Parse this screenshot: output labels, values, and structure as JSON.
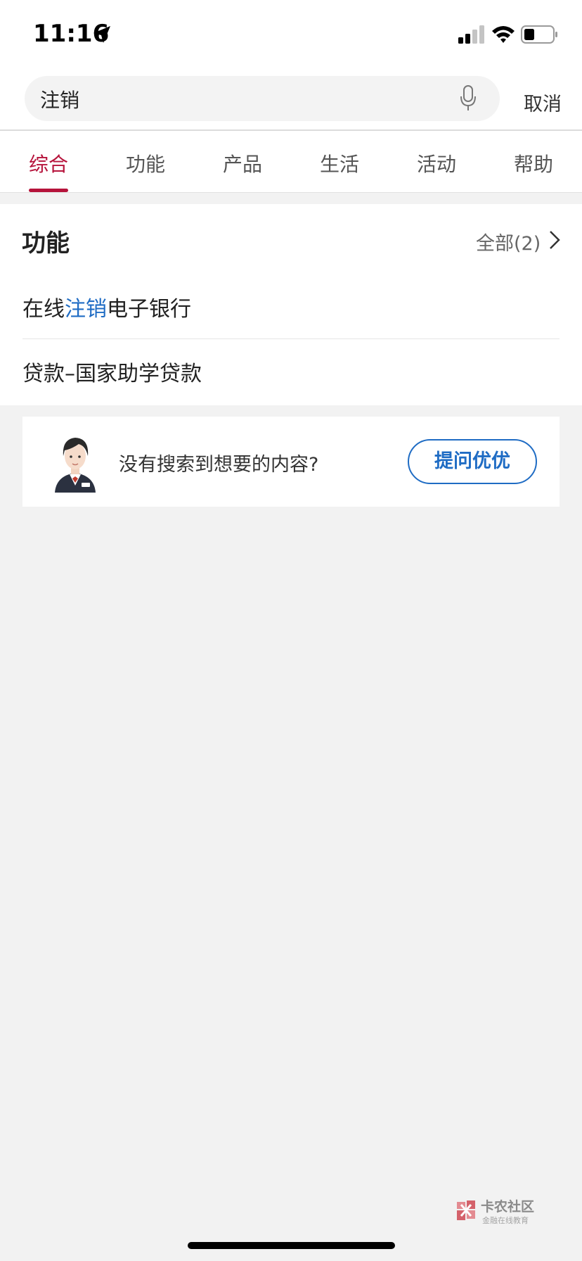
{
  "status_bar": {
    "time": "11:16"
  },
  "search": {
    "query": "注销",
    "cancel_label": "取消"
  },
  "tabs": [
    {
      "label": "综合",
      "active": true
    },
    {
      "label": "功能",
      "active": false
    },
    {
      "label": "产品",
      "active": false
    },
    {
      "label": "生活",
      "active": false
    },
    {
      "label": "活动",
      "active": false
    },
    {
      "label": "帮助",
      "active": false
    }
  ],
  "function_section": {
    "title": "功能",
    "all_label": "全部(2)",
    "results": [
      {
        "prefix": "在线",
        "highlight": "注销",
        "suffix": "电子银行"
      },
      {
        "text": "贷款–国家助学贷款"
      }
    ]
  },
  "ask": {
    "prompt": "没有搜索到想要的内容?",
    "button_label": "提问优优"
  },
  "watermark": {
    "title": "卡农社区",
    "subtitle": "金融在线教育"
  },
  "colors": {
    "accent_red": "#b6133b",
    "link_blue": "#1f6cc4",
    "background": "#f2f2f2"
  }
}
